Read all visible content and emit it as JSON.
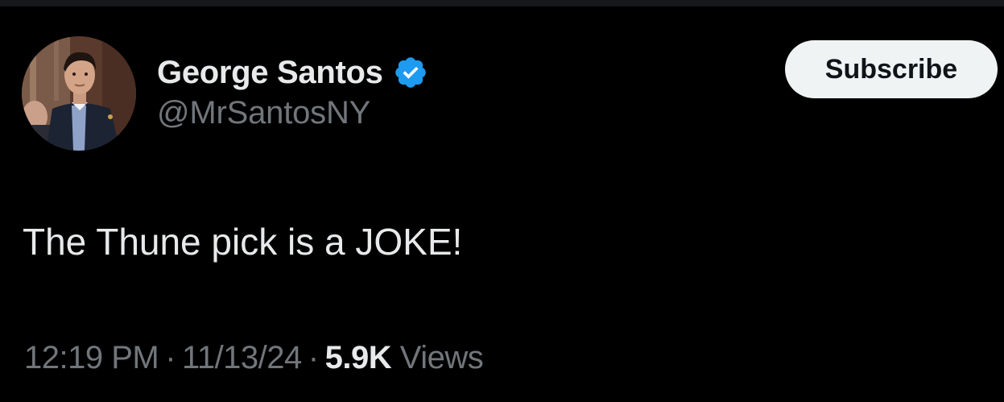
{
  "author": {
    "display_name": "George Santos",
    "handle": "@MrSantosNY",
    "verified": true
  },
  "actions": {
    "subscribe_label": "Subscribe"
  },
  "tweet": {
    "text": "The Thune pick is a JOKE!",
    "time": "12:19 PM",
    "date": "11/13/24",
    "views_count": "5.9K",
    "views_label": "Views",
    "separator": "·"
  },
  "colors": {
    "background": "#000000",
    "primary_text": "#e7e9ea",
    "secondary_text": "#71767b",
    "verified_badge": "#1d9bf0",
    "button_bg": "#eff3f4",
    "button_text": "#0f1419"
  },
  "icons": {
    "verified": "verified-badge-icon"
  }
}
